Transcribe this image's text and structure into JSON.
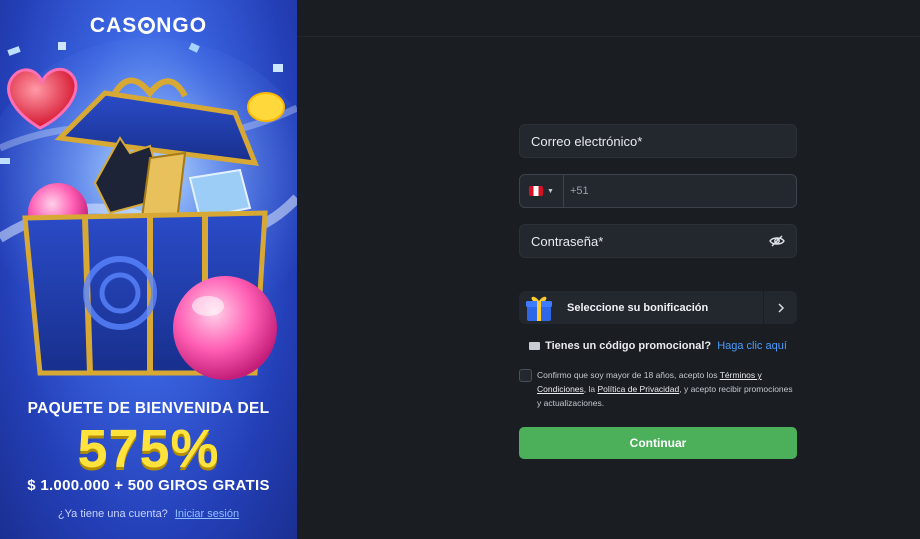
{
  "brand": {
    "name_prefix": "CAS",
    "name_suffix": "NGO"
  },
  "promo": {
    "title": "PAQUETE DE BIENVENIDA DEL",
    "percent": "575%",
    "amount": "$ 1.000.000 + 500 GIROS GRATIS",
    "account_question": "¿Ya tiene una cuenta?",
    "login_link": "Iniciar sesión"
  },
  "form": {
    "email_placeholder": "Correo electrónico*",
    "phone_code": "+51",
    "phone_country": "Peru",
    "password_placeholder": "Contraseña*",
    "bonus_label": "Seleccione su bonificación",
    "promo_question": "Tienes un código promocional?",
    "promo_link": "Haga clic aquí",
    "consent_part1": "Confirmo que soy mayor de 18 años, acepto los",
    "consent_terms": "Términos y Condiciones",
    "consent_part2": ", la",
    "consent_privacy": "Política de Privacidad",
    "consent_part3": ", y acepto recibir promociones y actualizaciones.",
    "submit_label": "Continuar"
  },
  "colors": {
    "accent_green": "#4caf5a",
    "link_blue": "#4a9cff",
    "promo_yellow": "#ffe23b",
    "background": "#1a1d22",
    "field": "#23272e"
  },
  "icons": [
    "gift-icon",
    "chevron-right-icon",
    "eye-icon",
    "ticket-icon",
    "peru-flag-icon",
    "caret-down-icon"
  ]
}
